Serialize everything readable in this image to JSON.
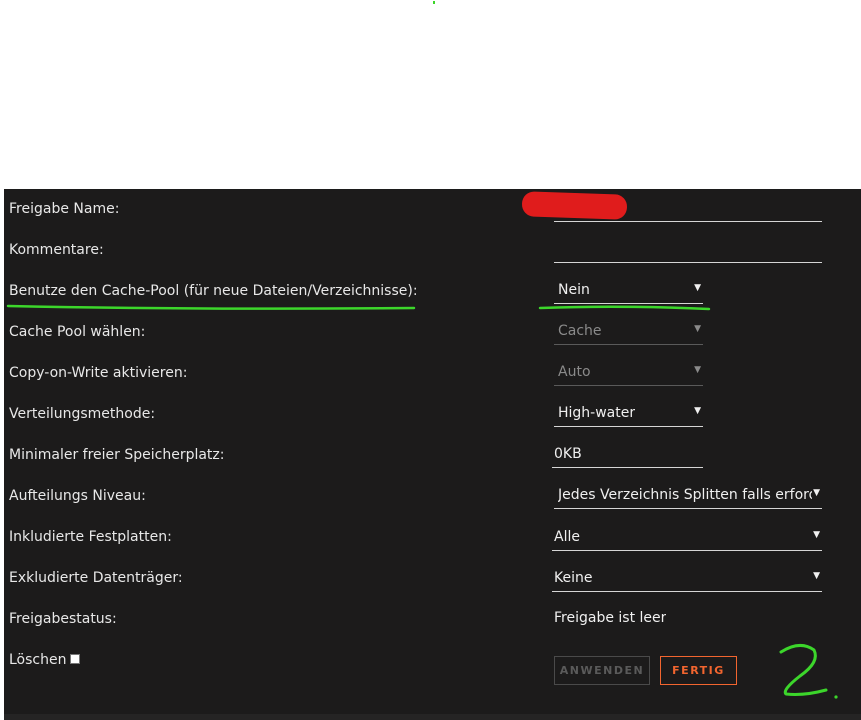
{
  "form": {
    "rows": [
      {
        "label": "Freigabe Name:",
        "value": ""
      },
      {
        "label": "Kommentare:",
        "value": ""
      },
      {
        "label": "Benutze den Cache-Pool (für neue Dateien/Verzeichnisse):",
        "value": "Nein"
      },
      {
        "label": "Cache Pool wählen:",
        "value": "Cache"
      },
      {
        "label": "Copy-on-Write aktivieren:",
        "value": "Auto"
      },
      {
        "label": "Verteilungsmethode:",
        "value": "High-water"
      },
      {
        "label": "Minimaler freier Speicherplatz:",
        "value": "0KB"
      },
      {
        "label": "Aufteilungs Niveau:",
        "value": "Jedes Verzeichnis Splitten falls erforde"
      },
      {
        "label": "Inkludierte Festplatten:",
        "value": "Alle"
      },
      {
        "label": "Exkludierte Datenträger:",
        "value": "Keine"
      },
      {
        "label": "Freigabestatus:",
        "value": "Freigabe ist leer"
      },
      {
        "label": "Löschen",
        "value": ""
      }
    ]
  },
  "buttons": {
    "apply": "ANWENDEN",
    "done": "FERTIG"
  },
  "annotation": {
    "handwritten": "2."
  },
  "colors": {
    "panel_bg": "#1c1b1b",
    "accent_orange": "#f2652f",
    "annotation_green": "#3cd62b",
    "redaction_red": "#e01c1c"
  },
  "icons": {
    "dropdown": "triangle-down-icon"
  }
}
